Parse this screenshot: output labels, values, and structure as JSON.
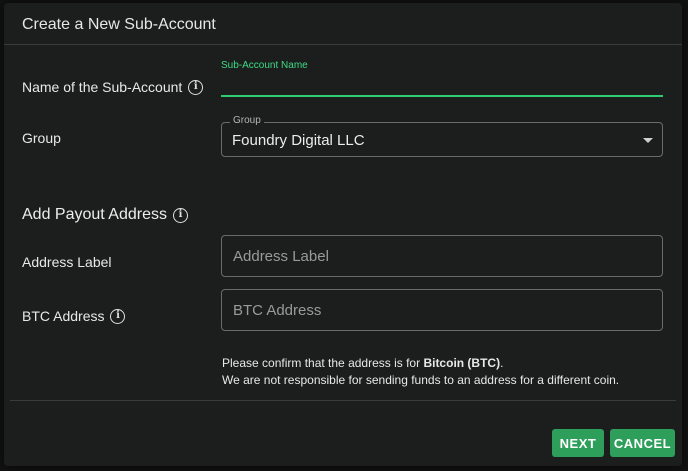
{
  "dialog": {
    "title": "Create a New Sub-Account"
  },
  "name_row": {
    "label": "Name of the Sub-Account",
    "field_label": "Sub-Account Name",
    "value": ""
  },
  "group_row": {
    "label": "Group",
    "field_label": "Group",
    "value": "Foundry Digital LLC"
  },
  "payout_section": {
    "title": "Add Payout Address"
  },
  "address_label_row": {
    "label": "Address Label",
    "placeholder": "Address Label"
  },
  "btc_row": {
    "label": "BTC Address",
    "placeholder": "BTC Address"
  },
  "notice": {
    "line1_prefix": "Please confirm that the address is for ",
    "line1_bold": "Bitcoin (BTC)",
    "line1_suffix": ".",
    "line2": "We are not responsible for sending funds to an address for a different coin."
  },
  "actions": {
    "next": "NEXT",
    "cancel": "CANCEL"
  },
  "colors": {
    "accent": "#2e9e5b",
    "active_field": "#2ecc71",
    "dialog_bg": "#1c1d1d"
  },
  "icons": {
    "info": "info-circle-icon",
    "dropdown": "caret-down-icon"
  }
}
